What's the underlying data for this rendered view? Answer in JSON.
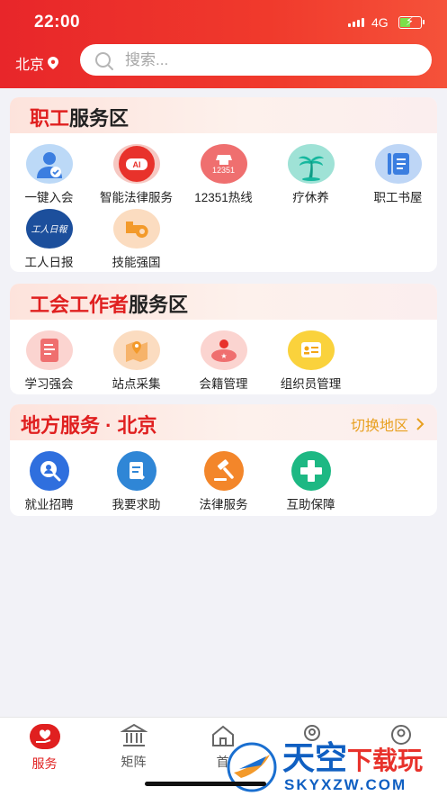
{
  "status_bar": {
    "time": "22:00",
    "network": "4G"
  },
  "header": {
    "city": "北京",
    "search_placeholder": "搜索..."
  },
  "sections": [
    {
      "title_red": "职工",
      "title_rest": "服务区",
      "items": [
        {
          "label": "一键入会",
          "icon": "join-union-icon"
        },
        {
          "label": "智能法律服务",
          "icon": "ai-legal-icon"
        },
        {
          "label": "12351热线",
          "icon": "hotline-phone-icon",
          "icon_text": "12351"
        },
        {
          "label": "疗休养",
          "icon": "palm-tree-icon"
        },
        {
          "label": "职工书屋",
          "icon": "book-icon"
        },
        {
          "label": "工人日报",
          "icon": "workers-daily-logo-icon",
          "icon_text": "工人日報"
        },
        {
          "label": "技能强国",
          "icon": "whistle-icon"
        }
      ]
    },
    {
      "title_red": "工会工作者",
      "title_rest": "服务区",
      "items": [
        {
          "label": "学习强会",
          "icon": "study-document-icon"
        },
        {
          "label": "站点采集",
          "icon": "map-pin-icon"
        },
        {
          "label": "会籍管理",
          "icon": "membership-badge-icon"
        },
        {
          "label": "组织员管理",
          "icon": "id-card-icon"
        }
      ]
    },
    {
      "title_red": "地方服务 · 北京",
      "title_rest": "",
      "switch_label": "切换地区",
      "items": [
        {
          "label": "就业招聘",
          "icon": "job-search-icon"
        },
        {
          "label": "我要求助",
          "icon": "help-request-icon"
        },
        {
          "label": "法律服务",
          "icon": "gavel-icon"
        },
        {
          "label": "互助保障",
          "icon": "medical-cross-icon"
        }
      ]
    }
  ],
  "tabbar": [
    {
      "label": "服务",
      "icon": "service-hand-heart-icon",
      "active": true
    },
    {
      "label": "矩阵",
      "icon": "building-columns-icon",
      "active": false
    },
    {
      "label": "首",
      "icon": "home-icon",
      "active": false
    },
    {
      "label": "",
      "icon": "location-person-icon",
      "active": false
    },
    {
      "label": "",
      "icon": "user-profile-icon",
      "active": false
    }
  ],
  "watermark": {
    "brand": "天空",
    "suffix": "下载玩",
    "domain": "SKYXZW.COM"
  },
  "colors": {
    "brand_red": "#e02020",
    "header_red": "#ec3129",
    "switch_orange": "#e8a020"
  }
}
